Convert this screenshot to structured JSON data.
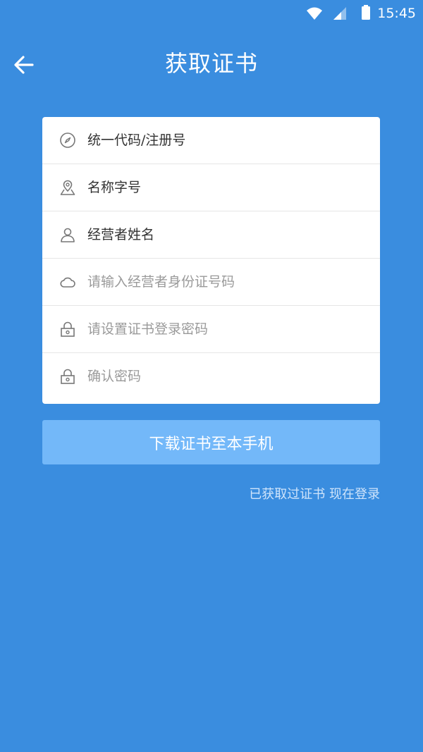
{
  "status_bar": {
    "time": "15:45",
    "icons": [
      "wifi-icon",
      "cellular-signal-icon",
      "battery-icon"
    ]
  },
  "header": {
    "back_icon": "arrow-left-icon",
    "title": "获取证书"
  },
  "form": {
    "fields": [
      {
        "icon": "compass-icon",
        "placeholder": "统一代码/注册号",
        "value": ""
      },
      {
        "icon": "location-pin-icon",
        "placeholder": "名称字号",
        "value": ""
      },
      {
        "icon": "person-icon",
        "placeholder": "经营者姓名",
        "value": ""
      },
      {
        "icon": "cloud-icon",
        "placeholder": "请输入经营者身份证号码",
        "value": ""
      },
      {
        "icon": "lock-icon",
        "placeholder": "请设置证书登录密码",
        "value": ""
      },
      {
        "icon": "lock-icon",
        "placeholder": "确认密码",
        "value": ""
      }
    ]
  },
  "download_button": {
    "label": "下载证书至本手机"
  },
  "login_link": {
    "label": "已获取过证书 现在登录"
  },
  "colors": {
    "background": "#3a8ddf",
    "button": "#73b8f9",
    "card": "#ffffff",
    "placeholder_gray": "#9a9a9a",
    "text_dark": "#333333"
  }
}
